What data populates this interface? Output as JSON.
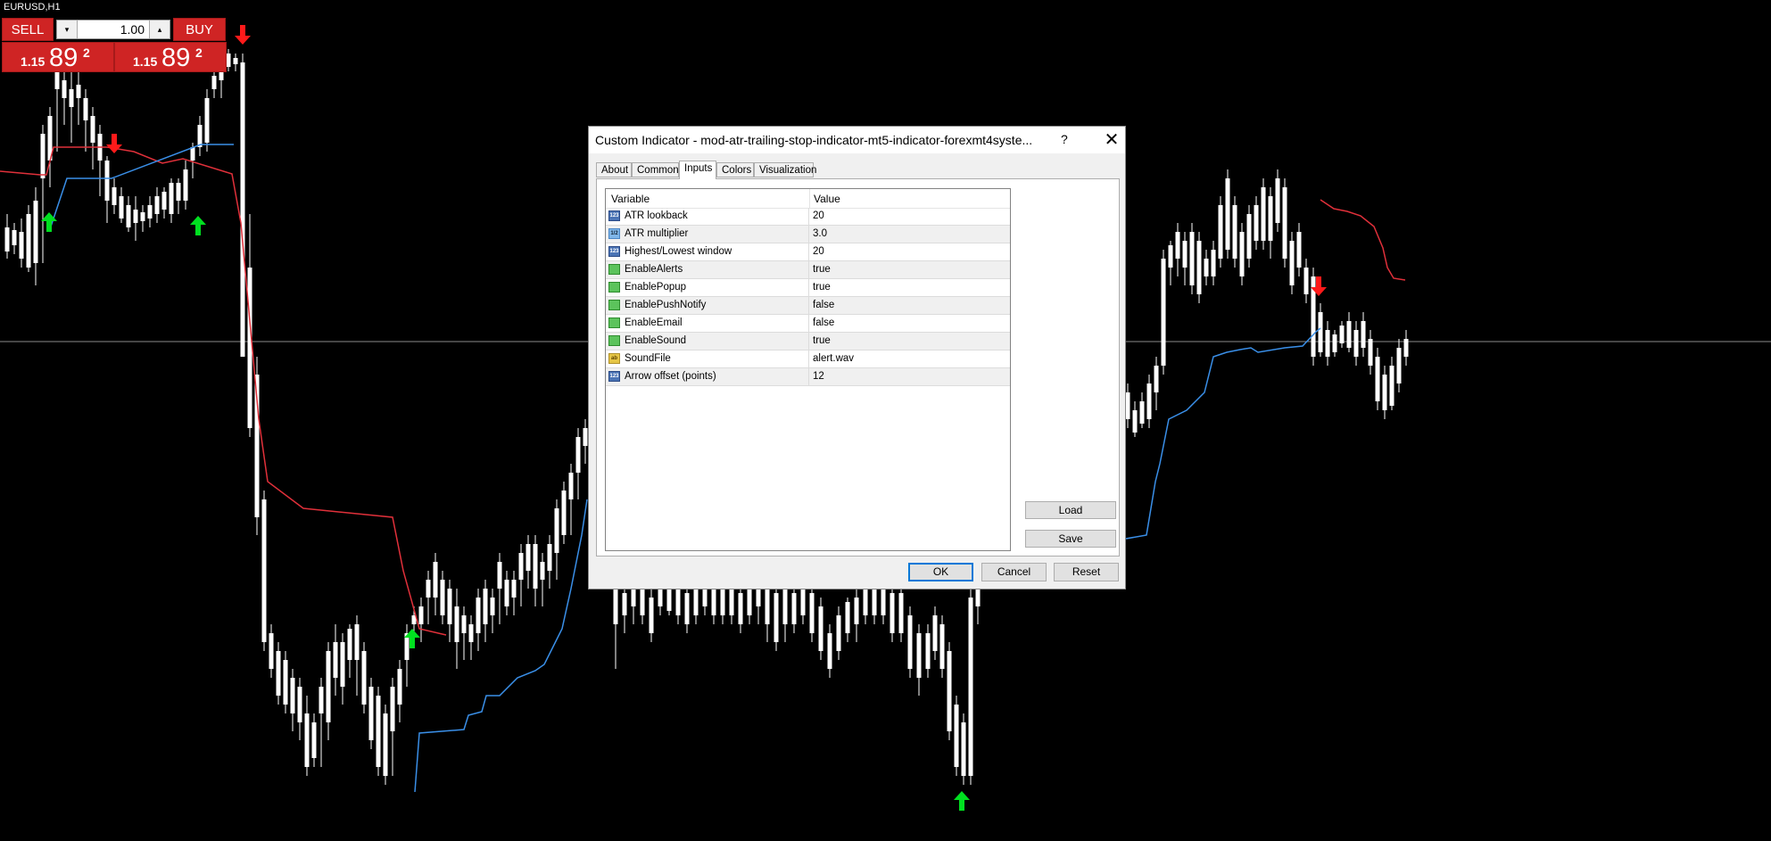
{
  "symbol": "EURUSD,H1",
  "trade_panel": {
    "sell_label": "SELL",
    "buy_label": "BUY",
    "lot_value": "1.00",
    "sell_price": {
      "small": "1.15",
      "big": "89",
      "sup": "2"
    },
    "buy_price": {
      "small": "1.15",
      "big": "89",
      "sup": "2"
    },
    "colors": {
      "button": "#cf2424"
    }
  },
  "dialog": {
    "title": "Custom Indicator - mod-atr-trailing-stop-indicator-mt5-indicator-forexmt4syste...",
    "help": "?",
    "close": "✕",
    "tabs": [
      {
        "label": "About"
      },
      {
        "label": "Common"
      },
      {
        "label": "Inputs",
        "active": true
      },
      {
        "label": "Colors"
      },
      {
        "label": "Visualization"
      }
    ],
    "grid": {
      "columns": [
        "Variable",
        "Value"
      ],
      "rows": [
        {
          "icon": "int-icon",
          "icon_text": "123",
          "name": "ATR lookback",
          "value": "20"
        },
        {
          "icon": "double-icon",
          "icon_text": "1/2",
          "name": "ATR multiplier",
          "value": "3.0"
        },
        {
          "icon": "int-icon",
          "icon_text": "123",
          "name": "Highest/Lowest window",
          "value": "20"
        },
        {
          "icon": "bool-icon",
          "icon_text": "",
          "name": "EnableAlerts",
          "value": "true"
        },
        {
          "icon": "bool-icon",
          "icon_text": "",
          "name": "EnablePopup",
          "value": "true"
        },
        {
          "icon": "bool-icon",
          "icon_text": "",
          "name": "EnablePushNotify",
          "value": "false"
        },
        {
          "icon": "bool-icon",
          "icon_text": "",
          "name": "EnableEmail",
          "value": "false"
        },
        {
          "icon": "bool-icon",
          "icon_text": "",
          "name": "EnableSound",
          "value": "true"
        },
        {
          "icon": "string-icon",
          "icon_text": "ab",
          "name": "SoundFile",
          "value": "alert.wav"
        },
        {
          "icon": "int-icon",
          "icon_text": "123",
          "name": "Arrow offset (points)",
          "value": "12"
        }
      ]
    },
    "load_label": "Load",
    "save_label": "Save",
    "ok_label": "OK",
    "cancel_label": "Cancel",
    "reset_label": "Reset"
  },
  "colors": {
    "background": "#000000",
    "bull_candle": "#1f1fff",
    "bear_candle": "#ffffff",
    "trail_down": "#e0303a",
    "trail_up": "#3a8fe8",
    "buy_arrow": "#00e020",
    "sell_arrow": "#ff1a1a",
    "price_line": "#8a8a8a"
  }
}
